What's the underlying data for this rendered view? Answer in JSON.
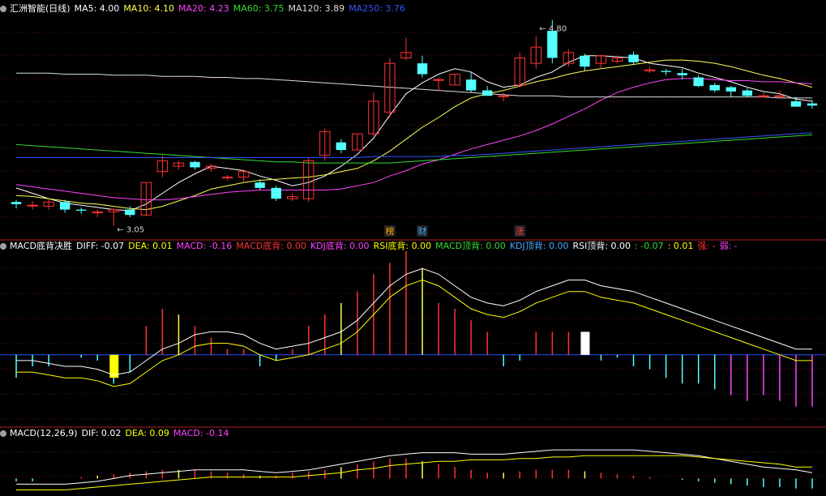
{
  "main_header": {
    "title": "汇洲智能(日线)",
    "ma": [
      {
        "label": "MA5: 4.00",
        "color": "#ffffff"
      },
      {
        "label": "MA10: 4.10",
        "color": "#ffff55"
      },
      {
        "label": "MA20: 4.23",
        "color": "#ff44ff"
      },
      {
        "label": "MA60: 3.75",
        "color": "#33dd33"
      },
      {
        "label": "MA120: 3.89",
        "color": "#dddddd"
      },
      {
        "label": "MA250: 3.76",
        "color": "#3355ff"
      }
    ]
  },
  "sub1_header": {
    "title": "MACD底背决胜",
    "items": [
      {
        "label": "DIFF: -0.07",
        "color": "#ffffff"
      },
      {
        "label": "DEA: 0.01",
        "color": "#ffff00"
      },
      {
        "label": "MACD: -0.16",
        "color": "#ff44ff"
      },
      {
        "label": "MACD底背: 0.00",
        "color": "#ff3333"
      },
      {
        "label": "KDJ底背: 0.00",
        "color": "#ff44ff"
      },
      {
        "label": "RSI底背: 0.00",
        "color": "#ffff00"
      },
      {
        "label": "MACD顶背: 0.00",
        "color": "#33dd33"
      },
      {
        "label": "KDJ顶背: 0.00",
        "color": "#44aaff"
      },
      {
        "label": "RSI顶背: 0.00",
        "color": "#ffffff"
      },
      {
        "label": ": -0.07",
        "color": "#33dd33"
      },
      {
        "label": ": 0.01",
        "color": "#ffff00"
      },
      {
        "label": "强: -",
        "color": "#ff3333"
      },
      {
        "label": "弱: -",
        "color": "#ff44ff"
      }
    ]
  },
  "sub2_header": {
    "title": "MACD(12,26,9)",
    "items": [
      {
        "label": "DIF: 0.02",
        "color": "#ffffff"
      },
      {
        "label": "DEA: 0.09",
        "color": "#ffff00"
      },
      {
        "label": "MACD: -0.14",
        "color": "#ff44ff"
      }
    ]
  },
  "chart_data": [
    {
      "type": "candlestick",
      "title": "汇洲智能(日线)",
      "ylim": [
        2.95,
        5.0
      ],
      "annotations": [
        {
          "text": "3.05",
          "index": 6,
          "value": 3.05
        },
        {
          "text": "4.80",
          "index": 32,
          "value": 4.8
        }
      ],
      "markers": [
        {
          "text": "榜",
          "index": 23,
          "color": "#ffaa00"
        },
        {
          "text": "财",
          "index": 25,
          "color": "#44aaff"
        },
        {
          "text": "涨",
          "index": 31,
          "color": "#ff4444"
        }
      ],
      "ohlc": [
        [
          3.27,
          3.29,
          3.21,
          3.25
        ],
        [
          3.24,
          3.28,
          3.2,
          3.24
        ],
        [
          3.23,
          3.29,
          3.2,
          3.27
        ],
        [
          3.27,
          3.29,
          3.17,
          3.2
        ],
        [
          3.2,
          3.22,
          3.16,
          3.19
        ],
        [
          3.17,
          3.2,
          3.13,
          3.18
        ],
        [
          3.18,
          3.21,
          3.05,
          3.2
        ],
        [
          3.2,
          3.23,
          3.13,
          3.15
        ],
        [
          3.15,
          3.45,
          3.14,
          3.45
        ],
        [
          3.55,
          3.7,
          3.5,
          3.65
        ],
        [
          3.6,
          3.65,
          3.57,
          3.63
        ],
        [
          3.64,
          3.65,
          3.57,
          3.59
        ],
        [
          3.58,
          3.62,
          3.55,
          3.6
        ],
        [
          3.5,
          3.52,
          3.47,
          3.5
        ],
        [
          3.5,
          3.57,
          3.46,
          3.55
        ],
        [
          3.45,
          3.48,
          3.38,
          3.4
        ],
        [
          3.4,
          3.42,
          3.28,
          3.3
        ],
        [
          3.3,
          3.35,
          3.28,
          3.32
        ],
        [
          3.3,
          3.68,
          3.27,
          3.65
        ],
        [
          3.7,
          3.95,
          3.65,
          3.92
        ],
        [
          3.82,
          3.85,
          3.72,
          3.75
        ],
        [
          3.75,
          3.9,
          3.75,
          3.9
        ],
        [
          3.9,
          4.28,
          3.88,
          4.2
        ],
        [
          4.1,
          4.6,
          4.05,
          4.55
        ],
        [
          4.6,
          4.79,
          4.58,
          4.65
        ],
        [
          4.55,
          4.62,
          4.42,
          4.45
        ],
        [
          4.4,
          4.42,
          4.3,
          4.4
        ],
        [
          4.35,
          4.45,
          4.35,
          4.45
        ],
        [
          4.4,
          4.47,
          4.28,
          4.3
        ],
        [
          4.3,
          4.34,
          4.25,
          4.25
        ],
        [
          4.25,
          4.28,
          4.2,
          4.25
        ],
        [
          4.35,
          4.65,
          4.33,
          4.6
        ],
        [
          4.55,
          4.8,
          4.5,
          4.7
        ],
        [
          4.85,
          4.95,
          4.55,
          4.6
        ],
        [
          4.55,
          4.68,
          4.52,
          4.65
        ],
        [
          4.62,
          4.64,
          4.48,
          4.52
        ],
        [
          4.55,
          4.62,
          4.5,
          4.62
        ],
        [
          4.57,
          4.62,
          4.55,
          4.6
        ],
        [
          4.63,
          4.66,
          4.54,
          4.56
        ],
        [
          4.48,
          4.52,
          4.46,
          4.49
        ],
        [
          4.48,
          4.5,
          4.44,
          4.47
        ],
        [
          4.46,
          4.5,
          4.4,
          4.44
        ],
        [
          4.42,
          4.44,
          4.33,
          4.34
        ],
        [
          4.35,
          4.37,
          4.28,
          4.3
        ],
        [
          4.33,
          4.34,
          4.24,
          4.29
        ],
        [
          4.3,
          4.32,
          4.24,
          4.25
        ],
        [
          4.25,
          4.28,
          4.24,
          4.25
        ],
        [
          4.25,
          4.3,
          4.24,
          4.25
        ],
        [
          4.2,
          4.24,
          4.15,
          4.15
        ],
        [
          4.18,
          4.21,
          4.13,
          4.16
        ]
      ],
      "series": [
        {
          "key": "MA5",
          "color": "#ffffff",
          "values": [
            3.4,
            3.35,
            3.3,
            3.26,
            3.24,
            3.22,
            3.2,
            3.19,
            3.25,
            3.35,
            3.45,
            3.53,
            3.6,
            3.58,
            3.56,
            3.51,
            3.47,
            3.42,
            3.45,
            3.51,
            3.6,
            3.71,
            3.86,
            4.07,
            4.27,
            4.37,
            4.45,
            4.5,
            4.47,
            4.38,
            4.33,
            4.35,
            4.42,
            4.47,
            4.56,
            4.62,
            4.62,
            4.61,
            4.6,
            4.55,
            4.53,
            4.51,
            4.46,
            4.42,
            4.38,
            4.33,
            4.29,
            4.27,
            4.22,
            4.2
          ]
        },
        {
          "key": "MA10",
          "color": "#ffff55",
          "values": [
            3.33,
            3.32,
            3.3,
            3.28,
            3.26,
            3.25,
            3.23,
            3.21,
            3.2,
            3.23,
            3.28,
            3.33,
            3.39,
            3.42,
            3.45,
            3.47,
            3.48,
            3.49,
            3.5,
            3.52,
            3.55,
            3.58,
            3.65,
            3.74,
            3.85,
            3.96,
            4.05,
            4.15,
            4.23,
            4.27,
            4.3,
            4.34,
            4.38,
            4.41,
            4.45,
            4.48,
            4.5,
            4.52,
            4.54,
            4.56,
            4.58,
            4.58,
            4.57,
            4.55,
            4.52,
            4.48,
            4.44,
            4.41,
            4.37,
            4.33
          ]
        },
        {
          "key": "MA20",
          "color": "#ff44ff",
          "values": [
            3.43,
            3.41,
            3.39,
            3.37,
            3.35,
            3.33,
            3.31,
            3.3,
            3.29,
            3.29,
            3.3,
            3.32,
            3.34,
            3.36,
            3.37,
            3.38,
            3.38,
            3.38,
            3.38,
            3.38,
            3.39,
            3.42,
            3.45,
            3.51,
            3.56,
            3.62,
            3.66,
            3.71,
            3.76,
            3.8,
            3.84,
            3.88,
            3.93,
            3.99,
            4.06,
            4.13,
            4.21,
            4.28,
            4.33,
            4.37,
            4.4,
            4.41,
            4.41,
            4.4,
            4.39,
            4.39,
            4.38,
            4.38,
            4.37,
            4.36
          ]
        },
        {
          "key": "MA60",
          "color": "#33dd33",
          "values": [
            3.8,
            3.79,
            3.78,
            3.77,
            3.76,
            3.75,
            3.74,
            3.73,
            3.72,
            3.71,
            3.7,
            3.69,
            3.68,
            3.67,
            3.66,
            3.65,
            3.64,
            3.64,
            3.63,
            3.63,
            3.63,
            3.63,
            3.63,
            3.63,
            3.64,
            3.65,
            3.66,
            3.67,
            3.68,
            3.69,
            3.7,
            3.71,
            3.72,
            3.73,
            3.74,
            3.75,
            3.76,
            3.77,
            3.78,
            3.79,
            3.8,
            3.81,
            3.82,
            3.83,
            3.84,
            3.85,
            3.86,
            3.87,
            3.88,
            3.89
          ]
        },
        {
          "key": "MA120",
          "color": "#dddddd",
          "values": [
            4.46,
            4.46,
            4.46,
            4.45,
            4.45,
            4.45,
            4.44,
            4.44,
            4.44,
            4.43,
            4.43,
            4.43,
            4.42,
            4.42,
            4.41,
            4.41,
            4.4,
            4.39,
            4.38,
            4.37,
            4.36,
            4.35,
            4.34,
            4.33,
            4.32,
            4.31,
            4.3,
            4.29,
            4.28,
            4.27,
            4.26,
            4.25,
            4.25,
            4.25,
            4.24,
            4.24,
            4.24,
            4.24,
            4.24,
            4.24,
            4.24,
            4.24,
            4.24,
            4.24,
            4.24,
            4.24,
            4.24,
            4.23,
            4.23,
            4.23
          ]
        },
        {
          "key": "MA250",
          "color": "#3355ff",
          "values": [
            3.68,
            3.68,
            3.68,
            3.68,
            3.68,
            3.68,
            3.68,
            3.68,
            3.68,
            3.68,
            3.68,
            3.68,
            3.68,
            3.68,
            3.68,
            3.68,
            3.68,
            3.68,
            3.68,
            3.68,
            3.68,
            3.68,
            3.69,
            3.69,
            3.69,
            3.69,
            3.69,
            3.7,
            3.7,
            3.71,
            3.72,
            3.73,
            3.74,
            3.75,
            3.76,
            3.77,
            3.78,
            3.79,
            3.8,
            3.81,
            3.82,
            3.83,
            3.84,
            3.85,
            3.86,
            3.87,
            3.88,
            3.89,
            3.9,
            3.91
          ]
        }
      ]
    },
    {
      "type": "bar",
      "title": "MACD底背决胜",
      "ylim": [
        -0.12,
        0.18
      ],
      "values": [
        -0.04,
        -0.02,
        -0.02,
        0.0,
        -0.005,
        -0.01,
        -0.05,
        -0.03,
        0.05,
        0.08,
        0.07,
        0.05,
        0.03,
        0.01,
        0.01,
        -0.02,
        -0.01,
        0.01,
        0.05,
        0.07,
        0.09,
        0.11,
        0.14,
        0.16,
        0.18,
        0.15,
        0.09,
        0.08,
        0.06,
        0.04,
        -0.02,
        -0.01,
        0.04,
        0.04,
        0.04,
        0.025,
        -0.01,
        -0.005,
        -0.02,
        -0.025,
        -0.04,
        -0.05,
        -0.05,
        -0.06,
        -0.07,
        -0.08,
        -0.07,
        -0.08,
        -0.09,
        -0.09
      ],
      "highlight_bars": [
        {
          "index": 6,
          "value": -0.04,
          "color": "#ffff00"
        },
        {
          "index": 35,
          "value": 0.04,
          "color": "#ffffff"
        }
      ],
      "series": [
        {
          "key": "DIFF",
          "color": "#ffffff",
          "values": [
            -0.01,
            -0.01,
            -0.015,
            -0.02,
            -0.02,
            -0.025,
            -0.035,
            -0.03,
            -0.01,
            0.01,
            0.02,
            0.035,
            0.04,
            0.04,
            0.035,
            0.02,
            0.01,
            0.015,
            0.02,
            0.03,
            0.04,
            0.06,
            0.09,
            0.12,
            0.14,
            0.15,
            0.14,
            0.12,
            0.1,
            0.09,
            0.085,
            0.095,
            0.11,
            0.12,
            0.13,
            0.13,
            0.12,
            0.115,
            0.11,
            0.1,
            0.09,
            0.08,
            0.07,
            0.06,
            0.05,
            0.04,
            0.03,
            0.02,
            0.01,
            0.01
          ]
        },
        {
          "key": "DEA",
          "color": "#ffff00",
          "values": [
            -0.01,
            -0.01,
            -0.015,
            -0.02,
            -0.02,
            -0.025,
            -0.035,
            -0.03,
            -0.01,
            0.01,
            0.02,
            0.035,
            0.04,
            0.04,
            0.035,
            0.02,
            0.01,
            0.015,
            0.02,
            0.03,
            0.04,
            0.06,
            0.09,
            0.12,
            0.14,
            0.15,
            0.14,
            0.12,
            0.1,
            0.09,
            0.085,
            0.095,
            0.11,
            0.12,
            0.13,
            0.13,
            0.12,
            0.115,
            0.11,
            0.1,
            0.09,
            0.08,
            0.07,
            0.06,
            0.05,
            0.04,
            0.03,
            0.02,
            0.01,
            0.01
          ]
        }
      ]
    },
    {
      "type": "bar",
      "title": "MACD(12,26,9)",
      "ylim": [
        -0.05,
        0.14
      ],
      "values": [
        -0.01,
        -0.01,
        0.0,
        0.0,
        0.005,
        0.01,
        0.015,
        0.02,
        0.025,
        0.03,
        0.03,
        0.03,
        0.025,
        0.02,
        0.015,
        0.01,
        0.01,
        0.02,
        0.025,
        0.03,
        0.04,
        0.05,
        0.06,
        0.07,
        0.07,
        0.06,
        0.05,
        0.04,
        0.03,
        0.02,
        0.02,
        0.025,
        0.03,
        0.03,
        0.03,
        0.025,
        0.02,
        0.015,
        0.01,
        0.005,
        0.0,
        -0.005,
        -0.01,
        -0.015,
        -0.02,
        -0.025,
        -0.03,
        -0.03,
        -0.035,
        -0.035
      ],
      "series": [
        {
          "key": "DIF",
          "color": "#ffffff",
          "values": [
            -0.02,
            -0.02,
            -0.02,
            -0.02,
            -0.015,
            -0.01,
            0.0,
            0.01,
            0.015,
            0.02,
            0.025,
            0.03,
            0.03,
            0.03,
            0.03,
            0.025,
            0.02,
            0.025,
            0.03,
            0.04,
            0.05,
            0.06,
            0.07,
            0.08,
            0.085,
            0.09,
            0.09,
            0.09,
            0.085,
            0.085,
            0.085,
            0.09,
            0.095,
            0.1,
            0.1,
            0.1,
            0.1,
            0.1,
            0.1,
            0.095,
            0.09,
            0.085,
            0.08,
            0.07,
            0.06,
            0.05,
            0.04,
            0.035,
            0.03,
            0.02
          ]
        },
        {
          "key": "DEA",
          "color": "#ffff00",
          "values": [
            -0.02,
            -0.02,
            -0.02,
            -0.02,
            -0.015,
            -0.01,
            -0.005,
            0.0,
            0.005,
            0.01,
            0.015,
            0.02,
            0.025,
            0.025,
            0.025,
            0.025,
            0.025,
            0.025,
            0.03,
            0.035,
            0.04,
            0.05,
            0.055,
            0.065,
            0.07,
            0.075,
            0.08,
            0.08,
            0.085,
            0.085,
            0.085,
            0.09,
            0.09,
            0.095,
            0.095,
            0.1,
            0.1,
            0.1,
            0.1,
            0.1,
            0.1,
            0.1,
            0.095,
            0.09,
            0.085,
            0.08,
            0.075,
            0.07,
            0.06,
            0.06
          ]
        }
      ]
    }
  ]
}
